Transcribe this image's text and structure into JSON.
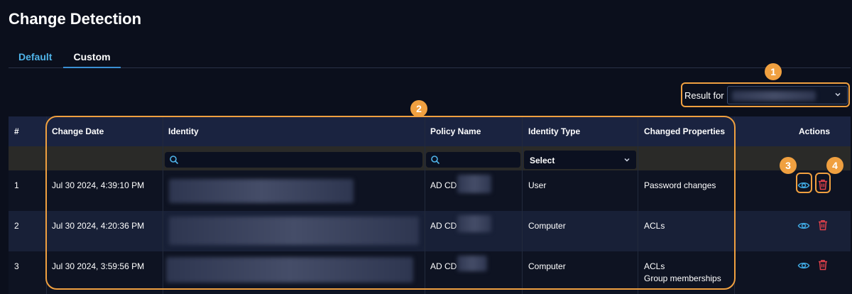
{
  "page": {
    "title": "Change Detection"
  },
  "tabs": [
    {
      "label": "Default"
    },
    {
      "label": "Custom"
    }
  ],
  "result_for": {
    "label": "Result for"
  },
  "table": {
    "columns": [
      "#",
      "Change Date",
      "Identity",
      "Policy Name",
      "Identity Type",
      "Changed Properties",
      "Actions"
    ],
    "identity_type_filter": "Select",
    "rows": [
      {
        "num": "1",
        "date": "Jul 30 2024, 4:39:10 PM",
        "policy": "AD CD",
        "type": "User",
        "props": [
          "Password changes"
        ]
      },
      {
        "num": "2",
        "date": "Jul 30 2024, 4:20:36 PM",
        "policy": "AD CD",
        "type": "Computer",
        "props": [
          "ACLs"
        ]
      },
      {
        "num": "3",
        "date": "Jul 30 2024, 3:59:56 PM",
        "policy": "AD CD",
        "type": "Computer",
        "props": [
          "ACLs",
          "Group memberships"
        ]
      }
    ]
  },
  "annotations": [
    "1",
    "2",
    "3",
    "4"
  ],
  "icons": {
    "view": "eye-icon",
    "delete": "trash-icon",
    "search": "search-icon",
    "dropdown": "chevron-down-icon"
  },
  "colors": {
    "accent_orange": "#f0a040",
    "tab_active": "#4fb3e8",
    "eye": "#3fa7e0",
    "trash": "#e0404a"
  }
}
